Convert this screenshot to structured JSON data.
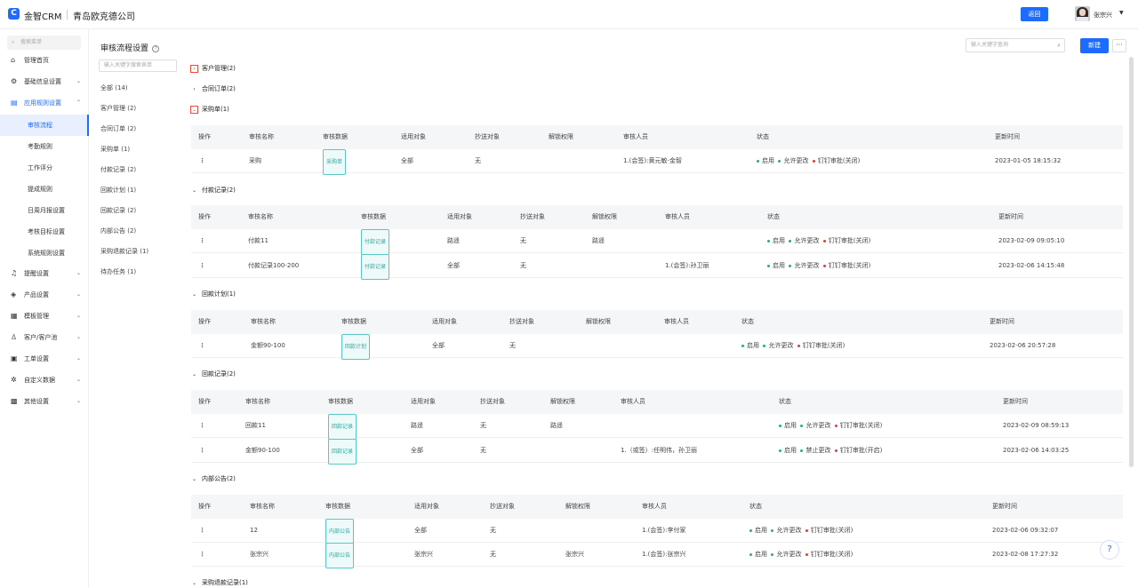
{
  "header": {
    "brand": "金智CRM",
    "company": "青岛欧克德公司",
    "return_label": "返回",
    "username": "张宗兴"
  },
  "sidebar": {
    "search_placeholder": "搜索菜单",
    "items": [
      {
        "label": "管理首页",
        "icon": "home-icon"
      },
      {
        "label": "基础信息设置",
        "icon": "settings-icon"
      },
      {
        "label": "应用规则设置",
        "icon": "document-icon"
      },
      {
        "label": "提醒设置",
        "icon": "bell-icon"
      },
      {
        "label": "产品设置",
        "icon": "box-icon"
      },
      {
        "label": "模板管理",
        "icon": "template-icon"
      },
      {
        "label": "客户/客户池",
        "icon": "users-icon"
      },
      {
        "label": "工单设置",
        "icon": "ticket-icon"
      },
      {
        "label": "自定义数据",
        "icon": "custom-data-icon"
      },
      {
        "label": "其他设置",
        "icon": "grid-icon"
      }
    ],
    "sub_items": [
      "审核流程",
      "考勤规则",
      "工作评分",
      "提成规则",
      "日周月报设置",
      "考核目标设置",
      "系统规则设置"
    ]
  },
  "page": {
    "title": "审核流程设置",
    "left_search_placeholder": "输入关键字搜索表单",
    "top_search_placeholder": "输入关键字查询",
    "new_label": "新建",
    "more_label": "···"
  },
  "categories": [
    "全部 (14)",
    "客户管理 (2)",
    "合同订单 (2)",
    "采购单 (1)",
    "付款记录 (2)",
    "回款计划 (1)",
    "回款记录 (2)",
    "内部公告 (2)",
    "采购退款记录 (1)",
    "待办任务 (1)"
  ],
  "groups": {
    "customer": "客户管理(2)",
    "contract": "合同订单(2)",
    "purchase": "采购单(1)",
    "payment": "付款记录(2)",
    "plan": "回款计划(1)",
    "receipt": "回款记录(2)",
    "notice": "内部公告(2)",
    "refund": "采购退款记录(1)"
  },
  "columns": {
    "op": "操作",
    "name": "审核名称",
    "data": "审核数据",
    "target": "适用对象",
    "cc": "抄送对象",
    "unlock": "解锁权限",
    "reviewer": "审核人员",
    "status": "状态",
    "updated": "更新时间"
  },
  "status_words": {
    "enable": "启用",
    "allow_change": "允许更改",
    "forbid_change": "禁止更改",
    "dingtalk_off": "钉钉审批(关闭)",
    "dingtalk_on": "钉钉审批(开启)"
  },
  "rows": {
    "purchase": [
      {
        "name": "采购",
        "tag": "采购单",
        "target": "全部",
        "cc": "无",
        "unlock": "",
        "reviewer": "1.(会签):黄元敏-金智",
        "updated": "2023-01-05 18:15:32"
      }
    ],
    "payment": [
      {
        "name": "付款11",
        "tag": "付款记录",
        "target": "路遥",
        "cc": "无",
        "unlock": "路遥",
        "reviewer": "",
        "updated": "2023-02-09 09:05:10"
      },
      {
        "name": "付款记录100-200",
        "tag": "付款记录",
        "target": "全部",
        "cc": "无",
        "unlock": "",
        "reviewer": "1.(会签):孙卫丽",
        "updated": "2023-02-06 14:15:48"
      }
    ],
    "plan": [
      {
        "name": "金额90-100",
        "tag": "回款计划",
        "target": "全部",
        "cc": "无",
        "unlock": "",
        "reviewer": "",
        "updated": "2023-02-06 20:57:28"
      }
    ],
    "receipt": [
      {
        "name": "回款11",
        "tag": "回款记录",
        "target": "路遥",
        "cc": "无",
        "unlock": "路遥",
        "reviewer": "",
        "updated": "2023-02-09 08:59:13"
      },
      {
        "name": "金额90-100",
        "tag": "回款记录",
        "target": "全部",
        "cc": "无",
        "unlock": "",
        "reviewer": "1.（或签）:任明伟，孙卫丽",
        "updated": "2023-02-06 14:03:25"
      }
    ],
    "notice": [
      {
        "name": "12",
        "tag": "内部公告",
        "target": "全部",
        "cc": "无",
        "unlock": "",
        "reviewer": "1.(会签):李付家",
        "updated": "2023-02-06 09:32:07"
      },
      {
        "name": "张宗兴",
        "tag": "内部公告",
        "target": "张宗兴",
        "cc": "无",
        "unlock": "张宗兴",
        "reviewer": "1.(会签):张宗兴",
        "updated": "2023-02-08 17:27:32"
      }
    ]
  },
  "colors": {
    "accent": "#1e6cff",
    "tag": "#2aa89e",
    "status_green": "#19b37a",
    "status_red": "#e03a3a"
  }
}
